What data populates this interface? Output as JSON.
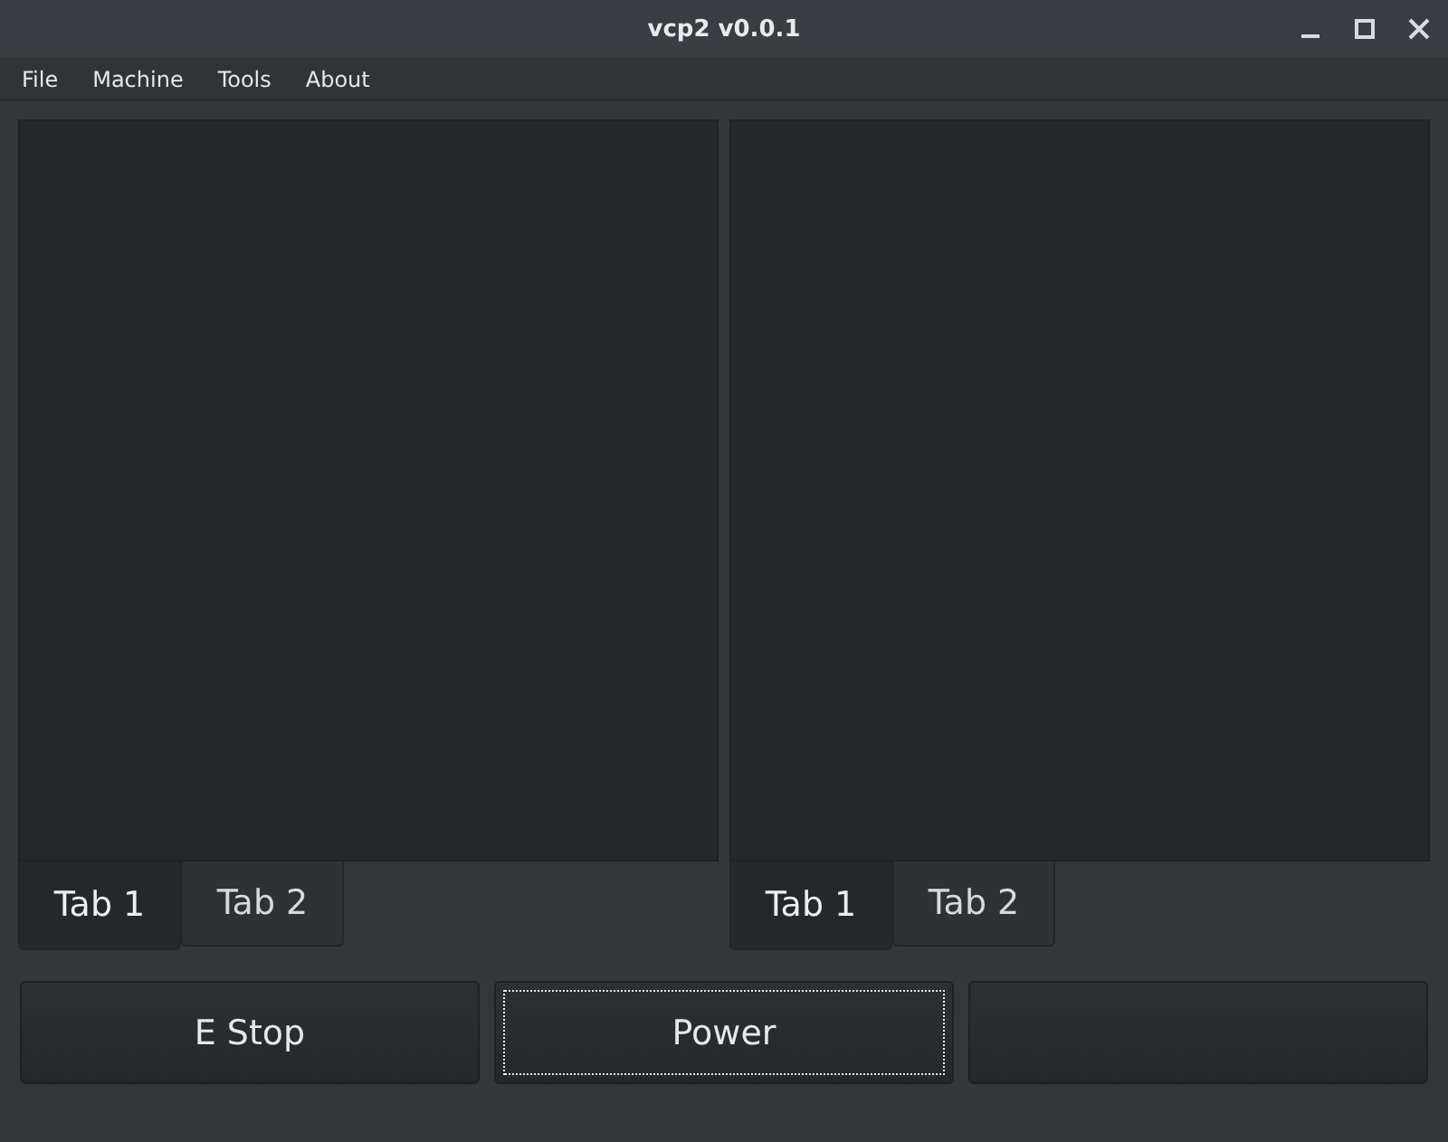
{
  "window": {
    "title": "vcp2 v0.0.1"
  },
  "menu": [
    "File",
    "Machine",
    "Tools",
    "About"
  ],
  "tab_panels": [
    {
      "tabs": [
        {
          "label": "Tab 1",
          "selected": true
        },
        {
          "label": "Tab 2",
          "selected": false
        }
      ]
    },
    {
      "tabs": [
        {
          "label": "Tab 1",
          "selected": true
        },
        {
          "label": "Tab 2",
          "selected": false
        }
      ]
    }
  ],
  "buttons": [
    {
      "label": "E Stop",
      "focused": false
    },
    {
      "label": "Power",
      "focused": true
    },
    {
      "focused": false
    }
  ]
}
